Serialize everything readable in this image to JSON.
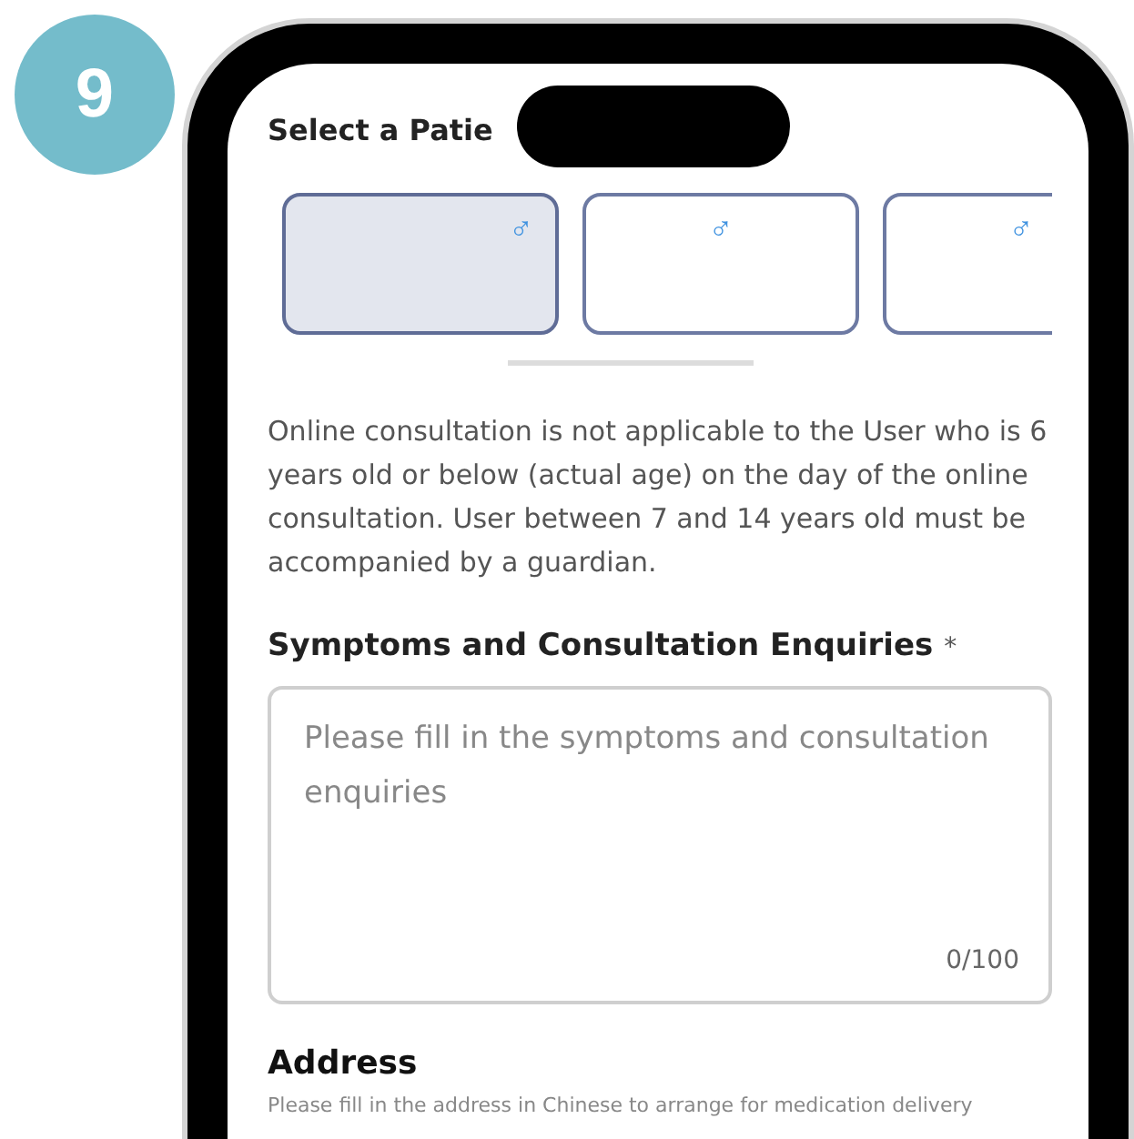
{
  "badge": "9",
  "screen": {
    "title": "Select a Patie",
    "patients": [
      {
        "gender_symbol": "♂",
        "selected": true
      },
      {
        "gender_symbol": "♂",
        "selected": false
      },
      {
        "gender_symbol": "♂",
        "selected": false
      }
    ],
    "notice": "Online consultation is not applicable to the User who is 6 years old or below (actual age) on the day of the online consultation. User between 7 and 14 years old must be accompanied by a guardian.",
    "symptoms": {
      "label": "Symptoms and Consultation Enquiries",
      "required_mark": "*",
      "placeholder": "Please fill in the symptoms and consultation enquiries",
      "counter": "0/100"
    },
    "address": {
      "label": "Address",
      "hint": "Please fill in the address in Chinese to arrange for medication delivery"
    }
  }
}
